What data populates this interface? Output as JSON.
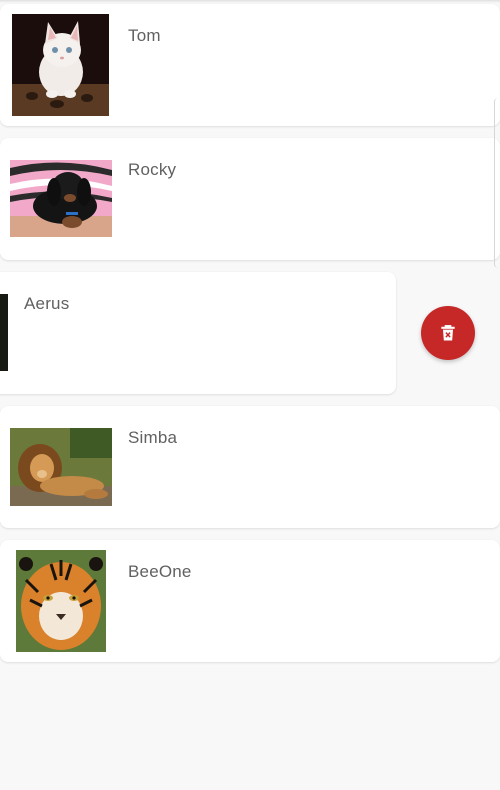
{
  "colors": {
    "background": "#f8f8f8",
    "card": "#ffffff",
    "name_text": "#616161",
    "delete_accent": "#c62828"
  },
  "pets": [
    {
      "name": "Tom",
      "image": "white-kitten-photo"
    },
    {
      "name": "Rocky",
      "image": "dachshund-puppy-photo"
    },
    {
      "name": "Aerus",
      "image": "dark-animal-photo",
      "swiped_open": true
    },
    {
      "name": "Simba",
      "image": "lion-photo"
    },
    {
      "name": "BeeOne",
      "image": "tiger-photo"
    }
  ],
  "swipe_action": {
    "icon": "delete-icon"
  }
}
